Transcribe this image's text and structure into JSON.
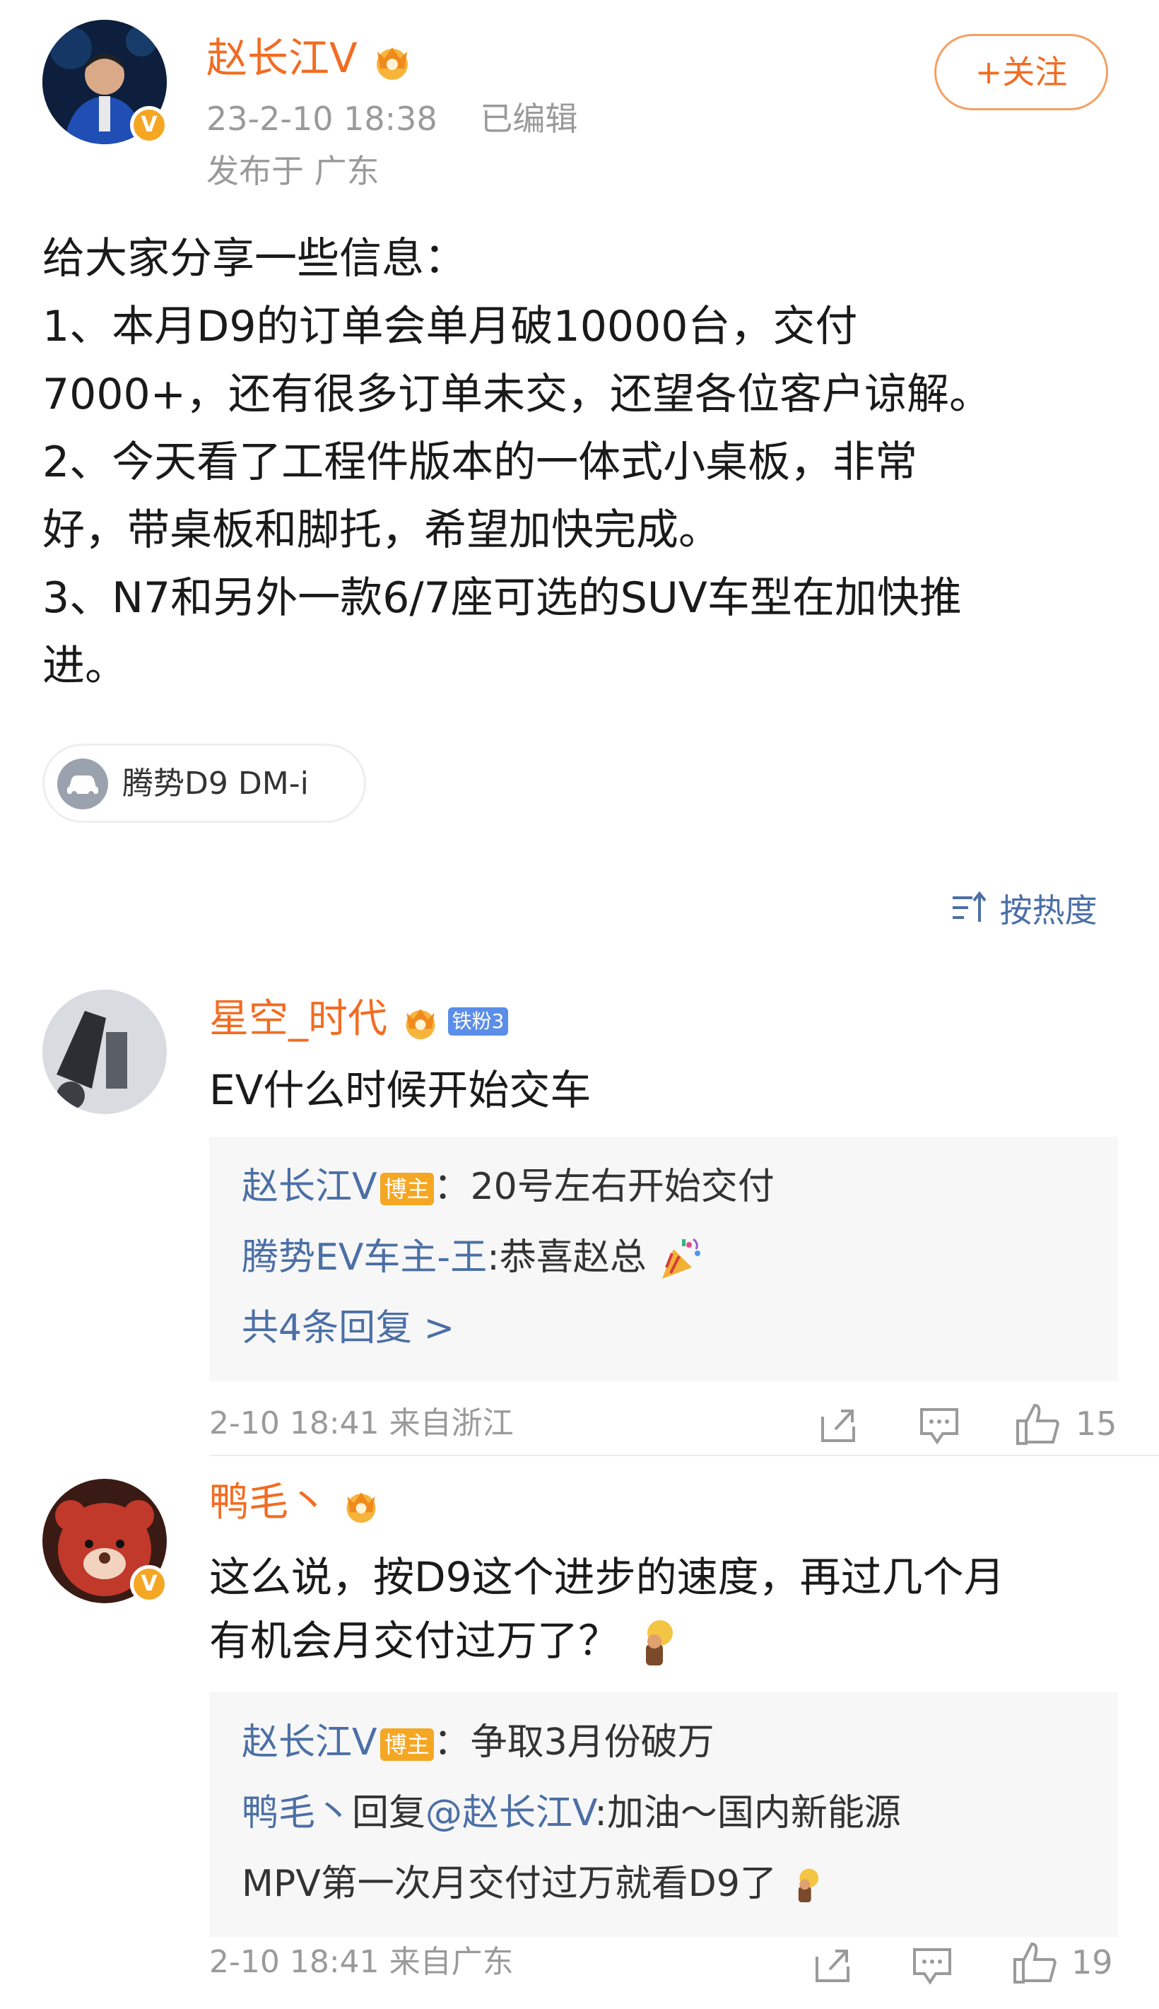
{
  "post": {
    "author": "赵长江V",
    "timestamp": "23-2-10 18:38",
    "edited": "已编辑",
    "location": "发布于 广东",
    "follow_label": "+关注",
    "text": "给大家分享一些信息：\n1、本月D9的订单会单月破10000台，交付\n7000+，还有很多订单未交，还望各位客户谅解。\n2、今天看了工程件版本的一体式小桌板，非常\n好，带桌板和脚托，希望加快完成。\n3、N7和另外一款6/7座可选的SUV车型在加快推\n进。",
    "topic_tag": "腾势D9 DM-i"
  },
  "sort_label": "按热度",
  "comments": [
    {
      "user": "星空_时代",
      "fan_badge": "铁粉3",
      "text": "EV什么时候开始交车",
      "replies": [
        {
          "name": "赵长江V",
          "badge": "博主",
          "text": "：20号左右开始交付"
        },
        {
          "name": "腾势EV车主-王",
          "text": ":恭喜赵总"
        }
      ],
      "more_replies": "共4条回复 >",
      "meta": "2-10 18:41 来自浙江",
      "likes": "15"
    },
    {
      "user": "鸭毛丶",
      "text_line1": "这么说，按D9这个进步的速度，再过几个月",
      "text_line2": "有机会月交付过万了？",
      "replies": [
        {
          "name": "赵长江V",
          "badge": "博主",
          "text": "：争取3月份破万"
        },
        {
          "name": "鸭毛丶",
          "reply_word": "回复",
          "mention": "@赵长江V",
          "text_line1": ":加油～国内新能源",
          "text_line2": "MPV第一次月交付过万就看D9了"
        }
      ],
      "meta": "2-10 18:41 来自广东",
      "likes": "19"
    }
  ],
  "colors": {
    "accent": "#f26c22",
    "link": "#4b6fa6",
    "meta": "#9a9a9a",
    "badge_gold": "#f5a623",
    "fan_badge": "#5b8ee8",
    "host_badge": "#f5a623"
  }
}
